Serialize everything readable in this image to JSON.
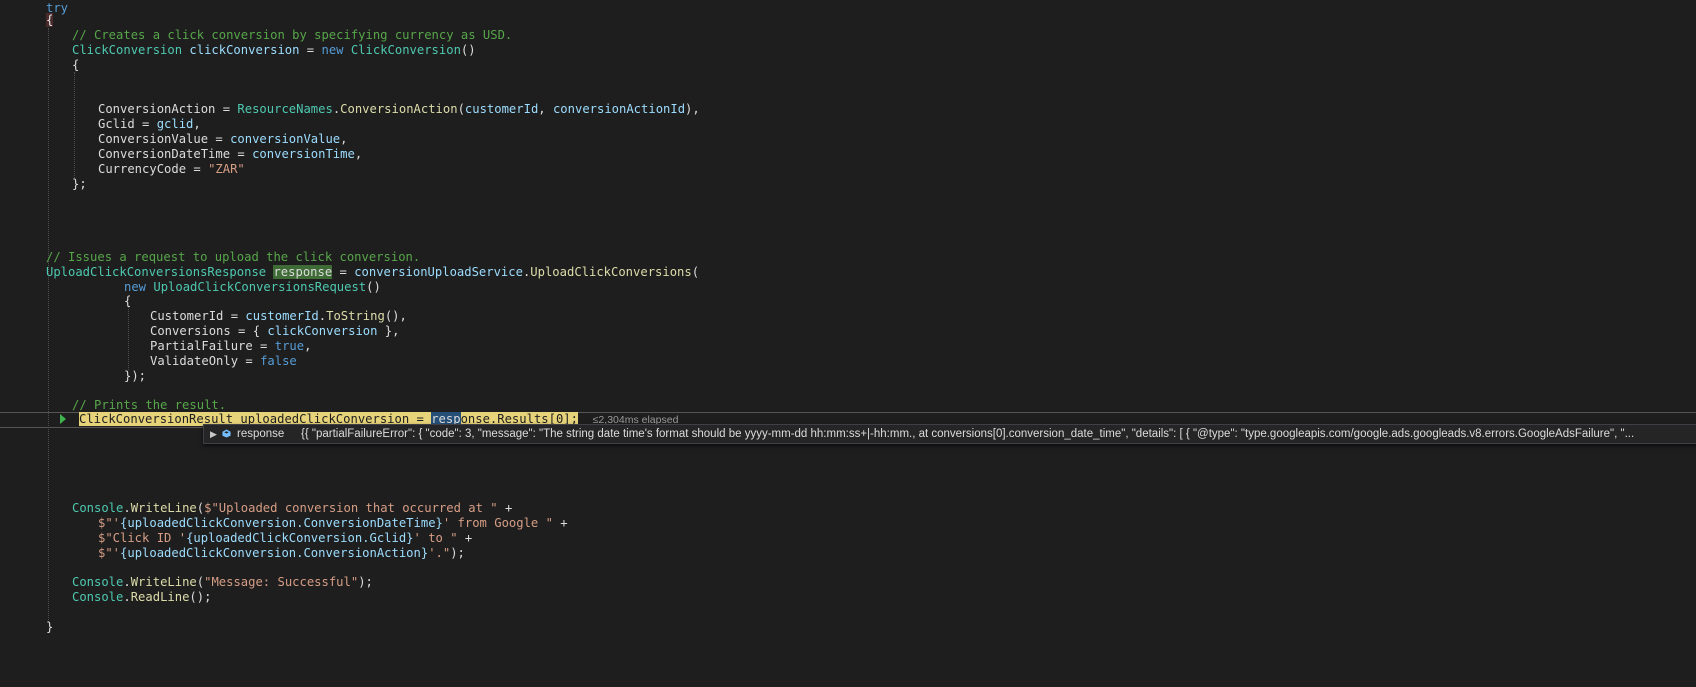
{
  "code": {
    "l0": "try",
    "l1": "{",
    "l2": "// Creates a click conversion by specifying currency as USD.",
    "l3_type": "ClickConversion",
    "l3_var": "clickConversion",
    "l3_eq": " = ",
    "l3_new": "new",
    "l3_ctor": "ClickConversion",
    "l3_end": "()",
    "l4": "{",
    "l5_prop": "ConversionAction = ",
    "l5_type": "ResourceNames",
    "l5_dot": ".",
    "l5_method": "ConversionAction",
    "l5_open": "(",
    "l5_arg1": "customerId",
    "l5_comma": ", ",
    "l5_arg2": "conversionActionId",
    "l5_close": "),",
    "l6_prop": "Gclid = ",
    "l6_val": "gclid",
    "l6_end": ",",
    "l7_prop": "ConversionValue = ",
    "l7_val": "conversionValue",
    "l7_end": ",",
    "l8_prop": "ConversionDateTime = ",
    "l8_val": "conversionTime",
    "l8_end": ",",
    "l9_prop": "CurrencyCode = ",
    "l9_str": "\"ZAR\"",
    "l10": "};",
    "l11": "// Issues a request to upload the click conversion.",
    "l12_type": "UploadClickConversionsResponse",
    "l12_sp": " ",
    "l12_var": "response",
    "l12_eq": " = ",
    "l12_svc": "conversionUploadService",
    "l12_dot": ".",
    "l12_method": "UploadClickConversions",
    "l12_open": "(",
    "l13_new": "new",
    "l13_sp": " ",
    "l13_type": "UploadClickConversionsRequest",
    "l13_end": "()",
    "l14": "{",
    "l15_prop": "CustomerId = ",
    "l15_val": "customerId",
    "l15_dot": ".",
    "l15_method": "ToString",
    "l15_end": "(),",
    "l16_prop": "Conversions = { ",
    "l16_val": "clickConversion",
    "l16_end": " },",
    "l17_prop": "PartialFailure = ",
    "l17_kw": "true",
    "l17_end": ",",
    "l18_prop": "ValidateOnly = ",
    "l18_kw": "false",
    "l19": "});",
    "l20": "// Prints the result.",
    "l21_a": "ClickConversionResult uploadedClickConversion = ",
    "l21_sel": "resp",
    "l21_b": "onse",
    "l21_c": ".Results[0];",
    "l21_elapsed": "≤2,304ms elapsed",
    "l22_cls": "Console",
    "l22_dot": ".",
    "l22_method": "WriteLine",
    "l22_open": "(",
    "l22_str": "$\"Uploaded conversion that occurred at \"",
    "l22_plus": " +",
    "l23_str1": "$\"'",
    "l23_expr": "{uploadedClickConversion.ConversionDateTime}",
    "l23_str2": "' from Google \"",
    "l23_plus": " +",
    "l24_str1": "$\"Click ID '",
    "l24_expr": "{uploadedClickConversion.Gclid}",
    "l24_str2": "' to \"",
    "l24_plus": " +",
    "l25_str1": "$\"'",
    "l25_expr": "{uploadedClickConversion.ConversionAction}",
    "l25_str2": "'.\"",
    "l25_end": ");",
    "l26_cls": "Console",
    "l26_dot": ".",
    "l26_method": "WriteLine",
    "l26_open": "(",
    "l26_str": "\"Message: Successful\"",
    "l26_end": ");",
    "l27_cls": "Console",
    "l27_dot": ".",
    "l27_method": "ReadLine",
    "l27_end": "();",
    "l28": "}"
  },
  "datatip": {
    "expand": "▶",
    "name": "response",
    "value": "{{ \"partialFailureError\": { \"code\": 3, \"message\": \"The string date time's format should be yyyy-mm-dd hh:mm:ss+|-hh:mm., at conversions[0].conversion_date_time\", \"details\": [ { \"@type\": \"type.googleapis.com/google.ads.googleads.v8.errors.GoogleAdsFailure\", \"..."
  },
  "colors": {
    "background": "#1e1e1e",
    "keyword": "#569cd6",
    "type": "#4ec9b0",
    "comment": "#57a64a",
    "string": "#d69d85",
    "variable": "#9cdcfe",
    "execution_highlight": "#e6d37a"
  },
  "icons": [
    "execution-arrow-icon",
    "object-icon",
    "expand-icon"
  ]
}
